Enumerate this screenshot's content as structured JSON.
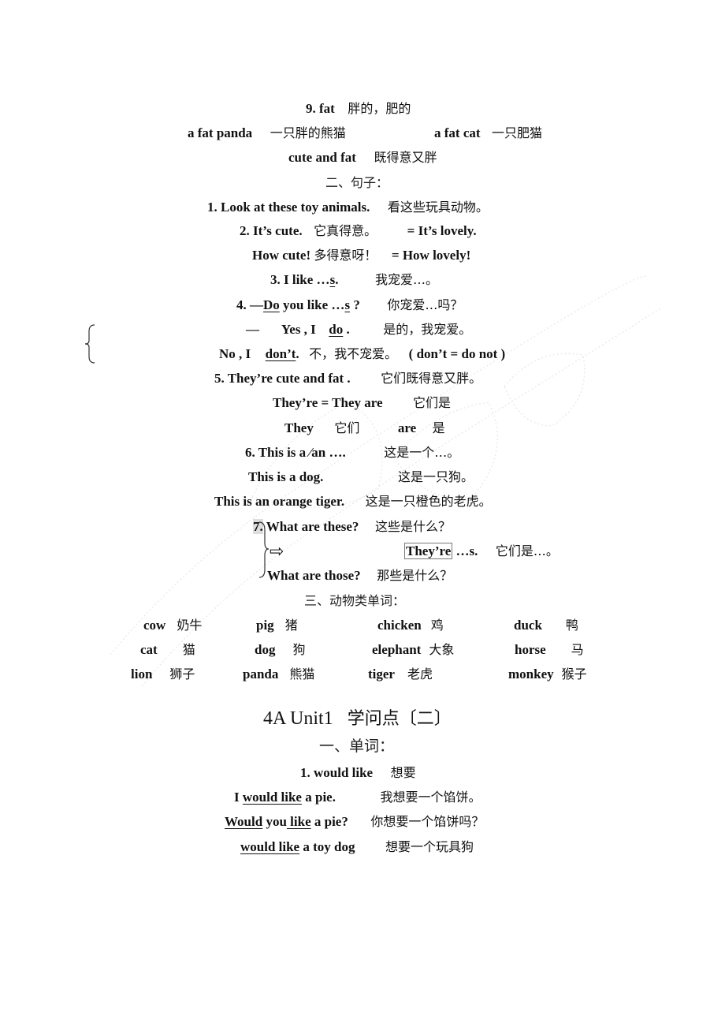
{
  "section_a": {
    "vocab9": {
      "word": "9. fat",
      "meaning": "胖的，肥的"
    },
    "ex1": {
      "en": "a fat panda",
      "zh": "一只胖的熊猫"
    },
    "ex2": {
      "en": "a fat cat",
      "zh": "一只肥猫"
    },
    "ex3": {
      "en": "cute and fat",
      "zh": "既得意又胖"
    }
  },
  "sentences": {
    "heading": "二、句子：",
    "s1": {
      "en": "1. Look at these toy animals.",
      "zh": "看这些玩具动物。"
    },
    "s2": {
      "en": "2. It’s cute.",
      "zh": "它真得意。",
      "eq": "= It’s lovely."
    },
    "s2b": {
      "en": "How cute!",
      "zh": "多得意呀！",
      "eq": "= How lovely!"
    },
    "s3": {
      "pre": "3. I like …",
      "u": "s",
      "post": ".",
      "zh": "我宠爱…。"
    },
    "s4": {
      "pre": "4. —",
      "u1": "Do",
      "mid": " you like …",
      "u2": "s",
      "post": " ?",
      "zh": "你宠爱…吗？"
    },
    "s4_yes": {
      "dash": "—",
      "pre": "Yes , I",
      "u": "do",
      "post": ".",
      "zh": "是的，我宠爱。"
    },
    "s4_no": {
      "pre": "No ,  I",
      "u": "don’t",
      "post": ".",
      "zh": "不，我不宠爱。",
      "note": "( don’t = do not )"
    },
    "s5": {
      "en": "5. They’re cute and fat .",
      "zh": "它们既得意又胖。"
    },
    "s5b": {
      "en": "They’re = They are",
      "zh": "它们是"
    },
    "s5c": {
      "en1": "They",
      "zh1": "它们",
      "en2": "are",
      "zh2": "是"
    },
    "s6": {
      "en": "6. This is a ⁄an ….",
      "zh": "这是一个…。"
    },
    "s6b": {
      "en": "This is a dog.",
      "zh": "这是一只狗。"
    },
    "s6c": {
      "en": "This is an orange tiger.",
      "zh": "这是一只橙色的老虎。"
    },
    "s7": {
      "num": "7.",
      "q1": {
        "en": "What are these?",
        "zh": "这些是什么？"
      },
      "arrow": "⇨",
      "ans": {
        "boxed": "They’re",
        "rest": " …s.",
        "zh": "它们是…。"
      },
      "q2": {
        "en": "What are those?",
        "zh": "那些是什么？"
      }
    }
  },
  "animals": {
    "heading": "三、动物类单词：",
    "rows": [
      [
        {
          "en": "cow",
          "zh": "奶牛"
        },
        {
          "en": "pig",
          "zh": "猪"
        },
        {
          "en": "chicken",
          "zh": "鸡"
        },
        {
          "en": "duck",
          "zh": "鸭"
        }
      ],
      [
        {
          "en": "cat",
          "zh": "猫"
        },
        {
          "en": "dog",
          "zh": "狗"
        },
        {
          "en": "elephant",
          "zh": "大象"
        },
        {
          "en": "horse",
          "zh": "马"
        }
      ],
      [
        {
          "en": "lion",
          "zh": "狮子"
        },
        {
          "en": "panda",
          "zh": "熊猫"
        },
        {
          "en": "tiger",
          "zh": "老虎"
        },
        {
          "en": "monkey",
          "zh": "猴子"
        }
      ]
    ]
  },
  "part2": {
    "title_en": "4A Unit1",
    "title_zh": "学问点〔二〕",
    "heading": "一、单词：",
    "vocab1": {
      "en": "1. would like",
      "zh": "想要"
    },
    "ex1": {
      "pre": "I ",
      "u": "would like",
      "post": " a pie.",
      "zh": "我想要一个馅饼。"
    },
    "ex2": {
      "u1": "Would",
      "mid": " you",
      "u2": " like",
      "post": " a pie?",
      "zh": "你想要一个馅饼吗？"
    },
    "ex3": {
      "u": "would like",
      "post": " a toy dog",
      "zh": "想要一个玩具狗"
    }
  }
}
